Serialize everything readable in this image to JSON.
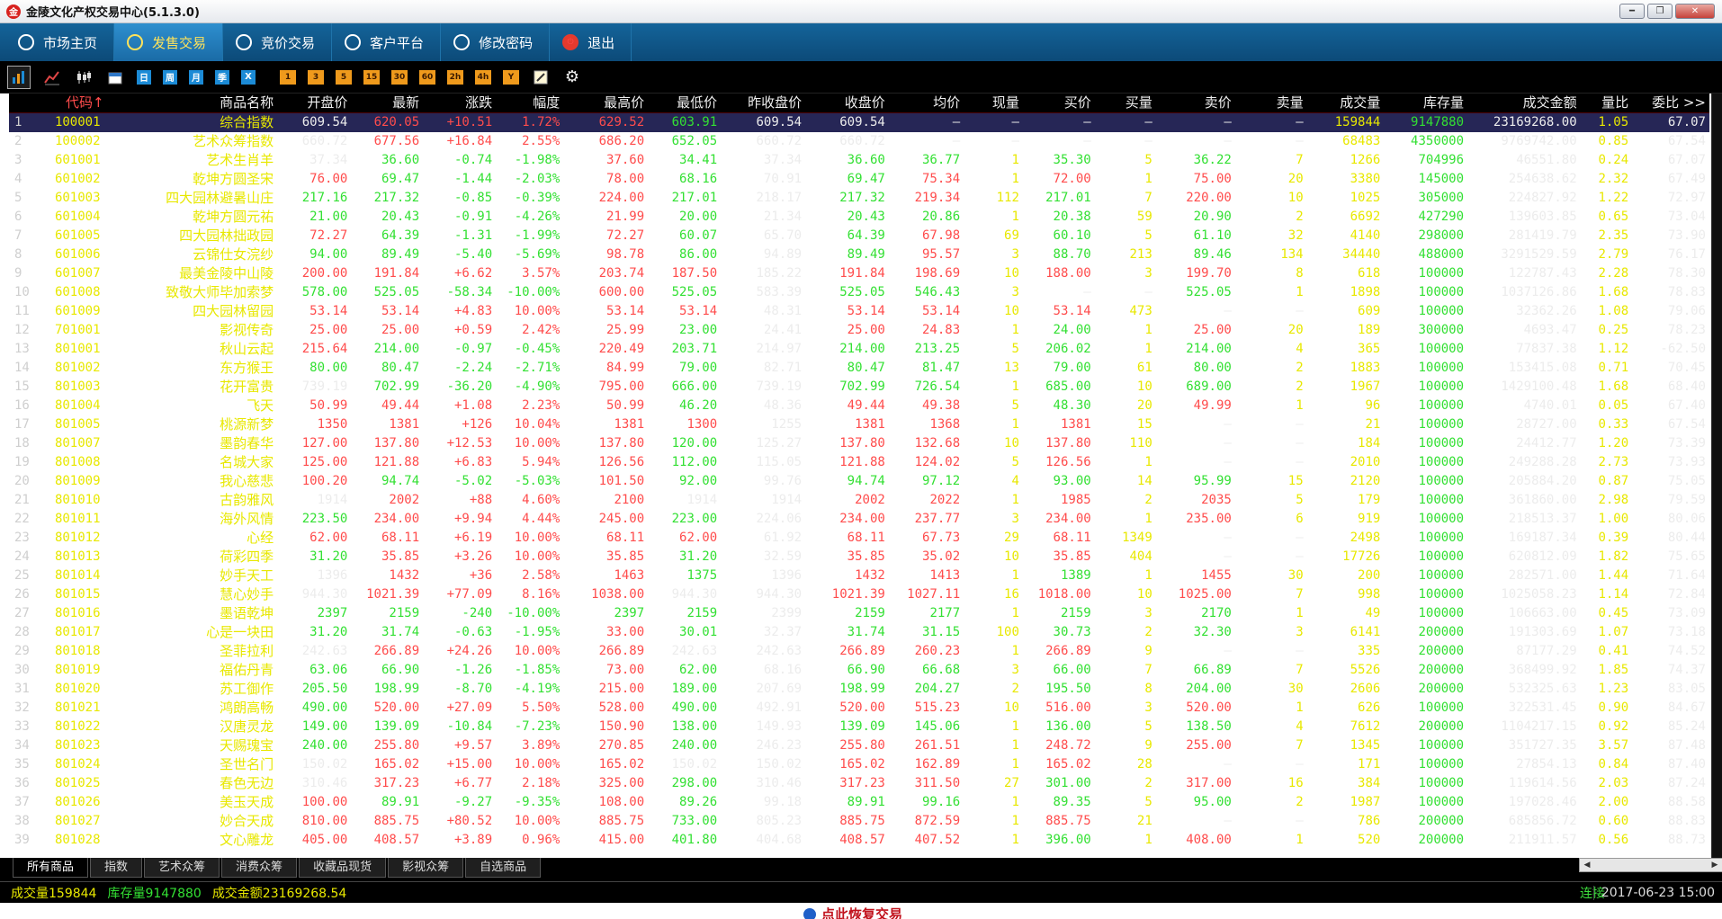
{
  "window": {
    "title": "金陵文化产权交易中心(5.1.3.0)",
    "logo_icon": "app-logo-icon",
    "controls": [
      "minimize",
      "restore",
      "close"
    ]
  },
  "nav": {
    "tabs": [
      {
        "label": "市场主页",
        "icon": "market-home-icon"
      },
      {
        "label": "发售交易",
        "icon": "issue-trade-icon",
        "active": true
      },
      {
        "label": "竞价交易",
        "icon": "auction-icon"
      },
      {
        "label": "客户平台",
        "icon": "client-platform-icon"
      },
      {
        "label": "修改密码",
        "icon": "password-icon"
      },
      {
        "label": "退出",
        "icon": "power-icon"
      }
    ]
  },
  "toolbar": {
    "period_buttons": [
      "日",
      "周",
      "月",
      "季",
      "X"
    ],
    "minute_buttons": [
      "1",
      "3",
      "5",
      "15",
      "30",
      "60",
      "2h",
      "4h",
      "Y"
    ],
    "colors": {
      "period_button": "#1c8bd6",
      "minute_button": "#ef9a1c"
    }
  },
  "table": {
    "headers": [
      "代码↑",
      "商品名称",
      "开盘价",
      "最新",
      "涨跌",
      "幅度",
      "最高价",
      "最低价",
      "昨收盘价",
      "收盘价",
      "均价",
      "现量",
      "买价",
      "买量",
      "卖价",
      "卖量",
      "成交量",
      "库存量",
      "成交金额",
      "量比",
      "委比 >>"
    ],
    "rows": [
      [
        "1",
        "100001",
        "综合指数",
        "609.54",
        "620.05",
        "+10.51",
        "1.72%",
        "629.52",
        "603.91",
        "609.54",
        "609.54",
        "—",
        "—",
        "—",
        "—",
        "—",
        "—",
        "159844",
        "9147880",
        "23169268.00",
        "1.05",
        "67.07"
      ],
      [
        "2",
        "100002",
        "艺术众筹指数",
        "660.72",
        "677.56",
        "+16.84",
        "2.55%",
        "686.20",
        "652.05",
        "660.72",
        "660.72",
        "—",
        "—",
        "—",
        "—",
        "—",
        "—",
        "68483",
        "4350000",
        "9769742.00",
        "0.85",
        "67.54"
      ],
      [
        "3",
        "601001",
        "艺术生肖羊",
        "37.34",
        "36.60",
        "-0.74",
        "-1.98%",
        "37.60",
        "34.41",
        "37.34",
        "36.60",
        "36.77",
        "1",
        "35.30",
        "5",
        "36.22",
        "7",
        "1266",
        "704996",
        "46551.80",
        "0.24",
        "67.07"
      ],
      [
        "4",
        "601002",
        "乾坤方圆圣宋",
        "76.00",
        "69.47",
        "-1.44",
        "-2.03%",
        "78.00",
        "68.16",
        "70.91",
        "69.47",
        "75.34",
        "1",
        "72.00",
        "1",
        "75.00",
        "20",
        "3380",
        "145000",
        "254638.62",
        "2.32",
        "67.49"
      ],
      [
        "5",
        "601003",
        "四大园林避暑山庄",
        "217.16",
        "217.32",
        "-0.85",
        "-0.39%",
        "224.00",
        "217.01",
        "218.17",
        "217.32",
        "219.34",
        "112",
        "217.01",
        "7",
        "220.00",
        "10",
        "1025",
        "305000",
        "224827.92",
        "1.22",
        "72.97"
      ],
      [
        "6",
        "601004",
        "乾坤方圆元祐",
        "21.00",
        "20.43",
        "-0.91",
        "-4.26%",
        "21.99",
        "20.00",
        "21.34",
        "20.43",
        "20.86",
        "1",
        "20.38",
        "59",
        "20.90",
        "2",
        "6692",
        "427290",
        "139603.85",
        "0.65",
        "73.04"
      ],
      [
        "7",
        "601005",
        "四大园林拙政园",
        "72.27",
        "64.39",
        "-1.31",
        "-1.99%",
        "72.27",
        "60.07",
        "65.70",
        "64.39",
        "67.98",
        "69",
        "60.10",
        "5",
        "61.10",
        "32",
        "4140",
        "298000",
        "281419.79",
        "2.35",
        "73.90"
      ],
      [
        "8",
        "601006",
        "云锦仕女浣纱",
        "94.00",
        "89.49",
        "-5.40",
        "-5.69%",
        "98.78",
        "86.00",
        "94.89",
        "89.49",
        "95.57",
        "3",
        "88.70",
        "213",
        "89.46",
        "134",
        "34440",
        "488000",
        "3291529.59",
        "2.79",
        "76.17"
      ],
      [
        "9",
        "601007",
        "最美金陵中山陵",
        "200.00",
        "191.84",
        "+6.62",
        "3.57%",
        "203.74",
        "187.50",
        "185.22",
        "191.84",
        "198.69",
        "10",
        "188.00",
        "3",
        "199.70",
        "8",
        "618",
        "100000",
        "122787.43",
        "2.28",
        "78.30"
      ],
      [
        "10",
        "601008",
        "致敬大师毕加索梦",
        "578.00",
        "525.05",
        "-58.34",
        "-10.00%",
        "600.00",
        "525.05",
        "583.39",
        "525.05",
        "546.43",
        "3",
        "—",
        "—",
        "525.05",
        "1",
        "1898",
        "100000",
        "1037126.86",
        "1.68",
        "78.83"
      ],
      [
        "11",
        "601009",
        "四大园林留园",
        "53.14",
        "53.14",
        "+4.83",
        "10.00%",
        "53.14",
        "53.14",
        "48.31",
        "53.14",
        "53.14",
        "10",
        "53.14",
        "473",
        "—",
        "—",
        "609",
        "100000",
        "32362.26",
        "1.08",
        "79.06"
      ],
      [
        "12",
        "701001",
        "影视传奇",
        "25.00",
        "25.00",
        "+0.59",
        "2.42%",
        "25.99",
        "23.00",
        "24.41",
        "25.00",
        "24.83",
        "1",
        "24.00",
        "1",
        "25.00",
        "20",
        "189",
        "300000",
        "4693.47",
        "0.25",
        "78.23"
      ],
      [
        "13",
        "801001",
        "秋山云起",
        "215.64",
        "214.00",
        "-0.97",
        "-0.45%",
        "220.49",
        "203.71",
        "214.97",
        "214.00",
        "213.25",
        "5",
        "206.02",
        "1",
        "214.00",
        "4",
        "365",
        "100000",
        "77837.38",
        "1.12",
        "-62.50"
      ],
      [
        "14",
        "801002",
        "东方猴王",
        "80.00",
        "80.47",
        "-2.24",
        "-2.71%",
        "84.99",
        "79.00",
        "82.71",
        "80.47",
        "81.47",
        "13",
        "79.00",
        "61",
        "80.00",
        "2",
        "1883",
        "100000",
        "153415.08",
        "0.71",
        "70.45"
      ],
      [
        "15",
        "801003",
        "花开富贵",
        "739.19",
        "702.99",
        "-36.20",
        "-4.90%",
        "795.00",
        "666.00",
        "739.19",
        "702.99",
        "726.54",
        "1",
        "685.00",
        "10",
        "689.00",
        "2",
        "1967",
        "100000",
        "1429100.48",
        "1.68",
        "68.40"
      ],
      [
        "16",
        "801004",
        "飞天",
        "50.99",
        "49.44",
        "+1.08",
        "2.23%",
        "50.99",
        "46.20",
        "48.36",
        "49.44",
        "49.38",
        "5",
        "48.30",
        "20",
        "49.99",
        "1",
        "96",
        "100000",
        "4740.01",
        "0.05",
        "67.40"
      ],
      [
        "17",
        "801005",
        "桃源新梦",
        "1350",
        "1381",
        "+126",
        "10.04%",
        "1381",
        "1300",
        "1255",
        "1381",
        "1368",
        "1",
        "1381",
        "15",
        "—",
        "—",
        "21",
        "100000",
        "28727.00",
        "0.33",
        "67.54"
      ],
      [
        "18",
        "801007",
        "墨韵春华",
        "127.00",
        "137.80",
        "+12.53",
        "10.00%",
        "137.80",
        "120.00",
        "125.27",
        "137.80",
        "132.68",
        "10",
        "137.80",
        "110",
        "—",
        "—",
        "184",
        "100000",
        "24412.77",
        "1.20",
        "73.39"
      ],
      [
        "19",
        "801008",
        "名城大家",
        "125.00",
        "121.88",
        "+6.83",
        "5.94%",
        "126.56",
        "112.00",
        "115.05",
        "121.88",
        "124.02",
        "5",
        "126.56",
        "1",
        "—",
        "—",
        "2010",
        "100000",
        "249288.28",
        "2.73",
        "73.93"
      ],
      [
        "20",
        "801009",
        "我心慈悲",
        "100.20",
        "94.74",
        "-5.02",
        "-5.03%",
        "101.50",
        "92.00",
        "99.76",
        "94.74",
        "97.12",
        "4",
        "93.00",
        "14",
        "95.99",
        "15",
        "2120",
        "100000",
        "205884.20",
        "0.87",
        "75.05"
      ],
      [
        "21",
        "801010",
        "古韵雅风",
        "1914",
        "2002",
        "+88",
        "4.60%",
        "2100",
        "1914",
        "1914",
        "2002",
        "2022",
        "1",
        "1985",
        "2",
        "2035",
        "5",
        "179",
        "100000",
        "361860.00",
        "2.98",
        "79.59"
      ],
      [
        "22",
        "801011",
        "海外风情",
        "223.50",
        "234.00",
        "+9.94",
        "4.44%",
        "245.00",
        "223.00",
        "224.06",
        "234.00",
        "237.77",
        "3",
        "234.00",
        "1",
        "235.00",
        "6",
        "919",
        "100000",
        "218513.37",
        "1.00",
        "80.06"
      ],
      [
        "23",
        "801012",
        "心经",
        "62.00",
        "68.11",
        "+6.19",
        "10.00%",
        "68.11",
        "62.00",
        "61.92",
        "68.11",
        "67.73",
        "29",
        "68.11",
        "1349",
        "—",
        "—",
        "2498",
        "100000",
        "169187.34",
        "0.39",
        "80.44"
      ],
      [
        "24",
        "801013",
        "荷彩四季",
        "31.20",
        "35.85",
        "+3.26",
        "10.00%",
        "35.85",
        "31.20",
        "32.59",
        "35.85",
        "35.02",
        "10",
        "35.85",
        "404",
        "—",
        "—",
        "17726",
        "100000",
        "620812.09",
        "1.82",
        "75.65"
      ],
      [
        "25",
        "801014",
        "妙手天工",
        "1396",
        "1432",
        "+36",
        "2.58%",
        "1463",
        "1375",
        "1396",
        "1432",
        "1413",
        "1",
        "1389",
        "1",
        "1455",
        "30",
        "200",
        "100000",
        "282571.00",
        "1.44",
        "71.64"
      ],
      [
        "26",
        "801015",
        "慧心妙手",
        "944.30",
        "1021.39",
        "+77.09",
        "8.16%",
        "1038.00",
        "944.30",
        "944.30",
        "1021.39",
        "1027.11",
        "16",
        "1018.00",
        "10",
        "1025.00",
        "7",
        "998",
        "100000",
        "1025058.23",
        "1.14",
        "72.84"
      ],
      [
        "27",
        "801016",
        "墨语乾坤",
        "2397",
        "2159",
        "-240",
        "-10.00%",
        "2397",
        "2159",
        "2399",
        "2159",
        "2177",
        "1",
        "2159",
        "3",
        "2170",
        "1",
        "49",
        "100000",
        "106663.00",
        "0.45",
        "73.09"
      ],
      [
        "28",
        "801017",
        "心是一块田",
        "31.20",
        "31.74",
        "-0.63",
        "-1.95%",
        "33.00",
        "30.01",
        "32.37",
        "31.74",
        "31.15",
        "100",
        "30.73",
        "2",
        "32.30",
        "3",
        "6141",
        "200000",
        "191303.69",
        "1.07",
        "73.18"
      ],
      [
        "29",
        "801018",
        "圣菲拉利",
        "242.63",
        "266.89",
        "+24.26",
        "10.00%",
        "266.89",
        "242.63",
        "242.63",
        "266.89",
        "260.23",
        "1",
        "266.89",
        "9",
        "—",
        "—",
        "335",
        "200000",
        "87177.29",
        "0.41",
        "74.52"
      ],
      [
        "30",
        "801019",
        "福佑丹青",
        "63.06",
        "66.90",
        "-1.26",
        "-1.85%",
        "73.00",
        "62.00",
        "68.16",
        "66.90",
        "66.68",
        "3",
        "66.00",
        "7",
        "66.89",
        "7",
        "5526",
        "200000",
        "368499.92",
        "1.85",
        "74.37"
      ],
      [
        "31",
        "801020",
        "苏工御作",
        "205.50",
        "198.99",
        "-8.70",
        "-4.19%",
        "215.00",
        "189.00",
        "207.69",
        "198.99",
        "204.27",
        "2",
        "195.50",
        "8",
        "204.00",
        "30",
        "2606",
        "200000",
        "532325.63",
        "1.23",
        "83.05"
      ],
      [
        "32",
        "801021",
        "鸿朗高畅",
        "490.00",
        "520.00",
        "+27.09",
        "5.50%",
        "528.00",
        "490.00",
        "492.91",
        "520.00",
        "515.23",
        "10",
        "516.00",
        "3",
        "520.00",
        "1",
        "626",
        "100000",
        "322531.45",
        "0.90",
        "84.67"
      ],
      [
        "33",
        "801022",
        "汉唐灵龙",
        "149.00",
        "139.09",
        "-10.84",
        "-7.23%",
        "150.90",
        "138.00",
        "149.93",
        "139.09",
        "145.06",
        "1",
        "136.00",
        "5",
        "138.50",
        "4",
        "7612",
        "200000",
        "1104217.15",
        "0.92",
        "85.24"
      ],
      [
        "34",
        "801023",
        "天赐瑰宝",
        "240.00",
        "255.80",
        "+9.57",
        "3.89%",
        "270.85",
        "240.00",
        "246.23",
        "255.80",
        "261.51",
        "1",
        "248.72",
        "9",
        "255.00",
        "7",
        "1345",
        "100000",
        "351727.35",
        "3.57",
        "87.48"
      ],
      [
        "35",
        "801024",
        "圣世名门",
        "150.02",
        "165.02",
        "+15.00",
        "10.00%",
        "165.02",
        "150.02",
        "150.02",
        "165.02",
        "162.89",
        "1",
        "165.02",
        "28",
        "—",
        "—",
        "171",
        "100000",
        "27854.13",
        "0.84",
        "87.40"
      ],
      [
        "36",
        "801025",
        "春色无边",
        "310.46",
        "317.23",
        "+6.77",
        "2.18%",
        "325.00",
        "298.00",
        "310.46",
        "317.23",
        "311.50",
        "27",
        "301.00",
        "2",
        "317.00",
        "16",
        "384",
        "100000",
        "119614.56",
        "2.03",
        "87.24"
      ],
      [
        "37",
        "801026",
        "美玉天成",
        "100.00",
        "89.91",
        "-9.27",
        "-9.35%",
        "108.00",
        "89.26",
        "99.18",
        "89.91",
        "99.16",
        "1",
        "89.35",
        "5",
        "95.00",
        "2",
        "1987",
        "100000",
        "197028.46",
        "2.00",
        "88.58"
      ],
      [
        "38",
        "801027",
        "妙合天成",
        "810.00",
        "885.75",
        "+80.52",
        "10.00%",
        "885.75",
        "733.00",
        "805.23",
        "885.75",
        "872.59",
        "1",
        "885.75",
        "21",
        "—",
        "—",
        "786",
        "200000",
        "685856.72",
        "0.60",
        "88.83"
      ],
      [
        "39",
        "801028",
        "文心雕龙",
        "405.00",
        "408.57",
        "+3.89",
        "0.96%",
        "415.00",
        "401.80",
        "404.68",
        "408.57",
        "407.52",
        "1",
        "396.00",
        "1",
        "408.00",
        "1",
        "520",
        "200000",
        "211911.57",
        "0.56",
        "88.73"
      ]
    ]
  },
  "sheet_tabs": [
    "所有商品",
    "指数",
    "艺术众筹",
    "消费众筹",
    "收藏品现货",
    "影视众筹",
    "自选商品"
  ],
  "status": {
    "volume": "成交量159844",
    "stock": "库存量9147880",
    "amount": "成交金额23169268.54",
    "connection": "连接",
    "datetime": "2017-06-23 15:00"
  },
  "bottom_link": "点此恢复交易",
  "colors": {
    "up": "#ff4c4c",
    "down": "#33e033",
    "flat": "#ececec",
    "code": "#e8e800",
    "nav_bg": "#0c4a78",
    "active_tab_text": "#ffe35a"
  }
}
